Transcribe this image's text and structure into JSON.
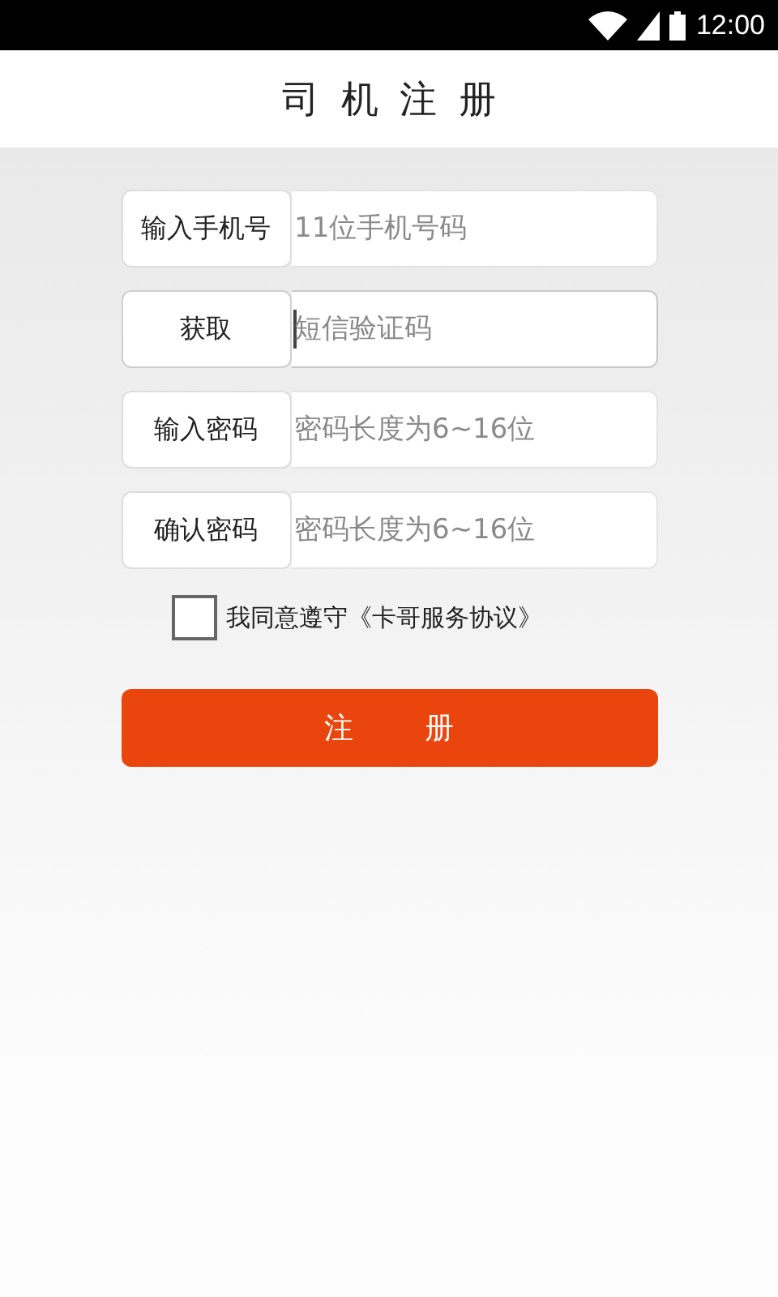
{
  "status_bar": {
    "time": "12:00"
  },
  "header": {
    "title": "司 机 注 册"
  },
  "fields": [
    {
      "kind": "label",
      "label": "输入手机号",
      "placeholder": "11位手机号码",
      "focused": false
    },
    {
      "kind": "button",
      "label": "获取",
      "placeholder": "短信验证码",
      "focused": true
    },
    {
      "kind": "label",
      "label": "输入密码",
      "placeholder": "密码长度为6~16位",
      "focused": false
    },
    {
      "kind": "label",
      "label": "确认密码",
      "placeholder": "密码长度为6~16位",
      "focused": false
    }
  ],
  "agreement": {
    "checked": false,
    "text": "我同意遵守《卡哥服务协议》"
  },
  "submit": {
    "label": "注 册"
  }
}
